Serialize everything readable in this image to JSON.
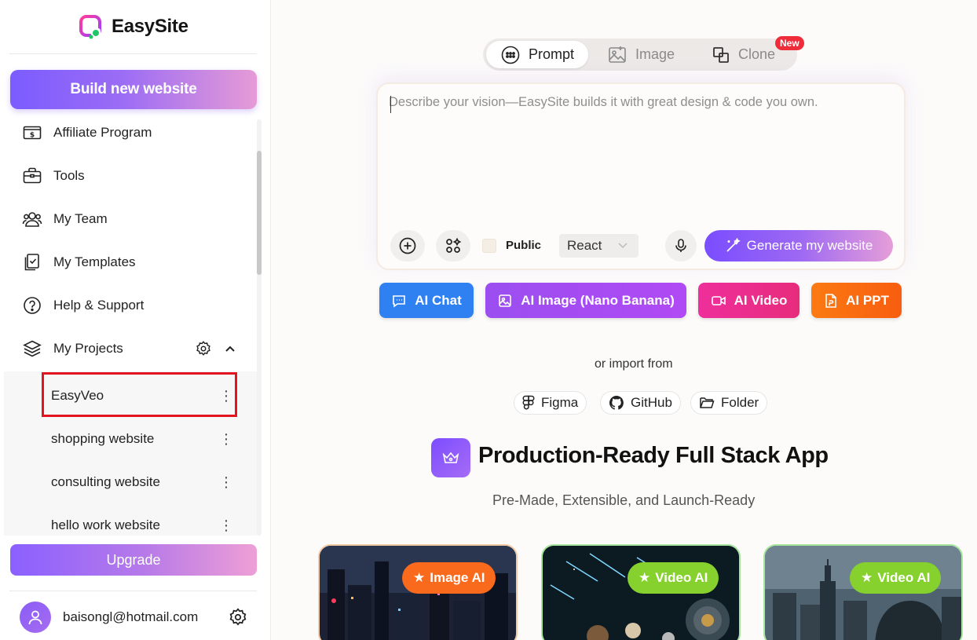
{
  "brand": {
    "name": "EasySite"
  },
  "sidebar": {
    "build_label": "Build new website",
    "items": [
      {
        "label": "Affiliate Program",
        "icon": "dollar-card-icon"
      },
      {
        "label": "Tools",
        "icon": "toolbox-icon"
      },
      {
        "label": "My Team",
        "icon": "team-icon"
      },
      {
        "label": "My Templates",
        "icon": "templates-icon"
      },
      {
        "label": "Help & Support",
        "icon": "help-icon"
      },
      {
        "label": "My Projects",
        "icon": "layers-icon"
      }
    ],
    "projects": [
      {
        "label": "EasyVeo",
        "selected": true
      },
      {
        "label": "shopping website"
      },
      {
        "label": "consulting website"
      },
      {
        "label": "hello work website"
      }
    ],
    "upgrade_label": "Upgrade",
    "user_email": "baisongl@hotmail.com"
  },
  "main": {
    "tabs": [
      {
        "label": "Prompt",
        "icon": "chat-bubble-icon",
        "active": true
      },
      {
        "label": "Image",
        "icon": "image-icon"
      },
      {
        "label": "Clone",
        "icon": "clone-icon",
        "badge": "New"
      }
    ],
    "prompt": {
      "placeholder": "Describe your vision—EasySite builds it with great design & code you own.",
      "public_label": "Public",
      "framework": "React",
      "generate_label": "Generate my website"
    },
    "ai_tools": [
      {
        "label": "AI Chat",
        "color": "#2f80f0"
      },
      {
        "label": "AI Image (Nano Banana)",
        "color": "#a646f2"
      },
      {
        "label": "AI Video",
        "color": "#ec2f8c"
      },
      {
        "label": "AI PPT",
        "color": "#fa6a12"
      }
    ],
    "import": {
      "label": "or import from",
      "sources": [
        {
          "label": "Figma",
          "icon": "figma-icon"
        },
        {
          "label": "GitHub",
          "icon": "github-icon"
        },
        {
          "label": "Folder",
          "icon": "folder-icon"
        }
      ]
    },
    "section": {
      "title": "Production-Ready Full Stack App",
      "subtitle": "Pre-Made, Extensible, and Launch-Ready"
    },
    "cards": [
      {
        "badge": "Image AI",
        "badge_color": "#fa6a1c",
        "border": "#f2c9a5"
      },
      {
        "badge": "Video AI",
        "badge_color": "#86d12e",
        "border": "#a8e6a0"
      },
      {
        "badge": "Video AI",
        "badge_color": "#86d12e",
        "border": "#a8e6a0"
      }
    ]
  }
}
